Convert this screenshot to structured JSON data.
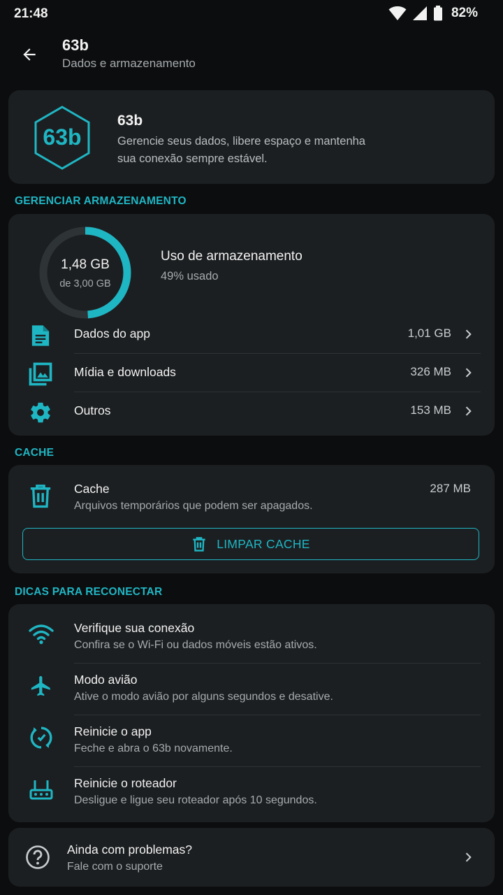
{
  "status_bar": {
    "time": "21:48",
    "battery": "82%"
  },
  "app_bar": {
    "title": "63b",
    "subtitle": "Dados e armazenamento"
  },
  "hero": {
    "logo_text": "63b",
    "title": "63b",
    "description": "Gerencie seus dados, libere espaço e mantenha sua conexão sempre estável."
  },
  "sections": {
    "storage": "GERENCIAR ARMAZENAMENTO",
    "cache": "CACHE",
    "tips": "DICAS PARA RECONECTAR"
  },
  "storage": {
    "used": "1,48 GB",
    "total": "de 3,00 GB",
    "used_fraction": 0.49,
    "title": "Uso de armazenamento",
    "percent": "49% usado",
    "items": [
      {
        "label": "Dados do app",
        "value": "1,01 GB",
        "icon": "document-icon"
      },
      {
        "label": "Mídia e downloads",
        "value": "326 MB",
        "icon": "media-library-icon"
      },
      {
        "label": "Outros",
        "value": "153 MB",
        "icon": "gear-icon"
      }
    ]
  },
  "cache": {
    "title": "Cache",
    "subtitle": "Arquivos temporários que podem ser apagados.",
    "size": "287 MB",
    "button_label": "LIMPAR CACHE"
  },
  "tips": [
    {
      "title": "Verifique sua conexão",
      "subtitle": "Confira se o Wi-Fi ou dados móveis estão ativos.",
      "icon": "wifi-icon"
    },
    {
      "title": "Modo avião",
      "subtitle": "Ative o modo avião por alguns segundos e desative.",
      "icon": "airplane-icon"
    },
    {
      "title": "Reinicie o app",
      "subtitle": "Feche e abra o 63b novamente.",
      "icon": "restart-icon"
    },
    {
      "title": "Reinicie o roteador",
      "subtitle": "Desligue e ligue seu roteador após 10 segundos.",
      "icon": "router-icon"
    }
  ],
  "support": {
    "title": "Ainda com problemas?",
    "subtitle": "Fale com o suporte"
  },
  "colors": {
    "accent": "#1fb6c4",
    "background": "#0c0d0e",
    "card": "#1c1f21"
  }
}
